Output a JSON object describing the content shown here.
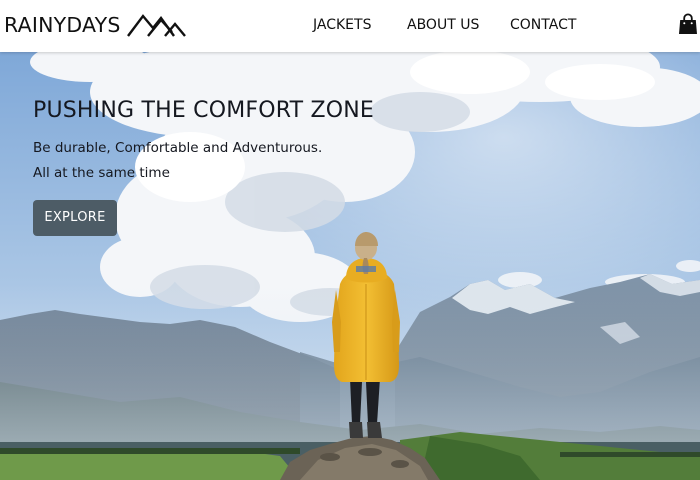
{
  "brand": {
    "name": "RAINYDAYS",
    "logo_icon": "mountain-peaks-icon"
  },
  "nav": {
    "items": [
      {
        "label": "JACKETS"
      },
      {
        "label": "ABOUT US"
      },
      {
        "label": "CONTACT"
      }
    ]
  },
  "cart": {
    "icon": "shopping-bag-icon"
  },
  "hero": {
    "title": "PUSHING THE COMFORT ZONE",
    "subtitle_line1": "Be durable, Comfortable and Adventurous.",
    "subtitle_line2": "All at the same time",
    "cta_label": "EXPLORE",
    "image": "woman-in-yellow-raincoat-on-mountain-peak"
  },
  "colors": {
    "button_bg": "#4d5c66",
    "text": "#151820",
    "jacket": "#f0b92a"
  }
}
